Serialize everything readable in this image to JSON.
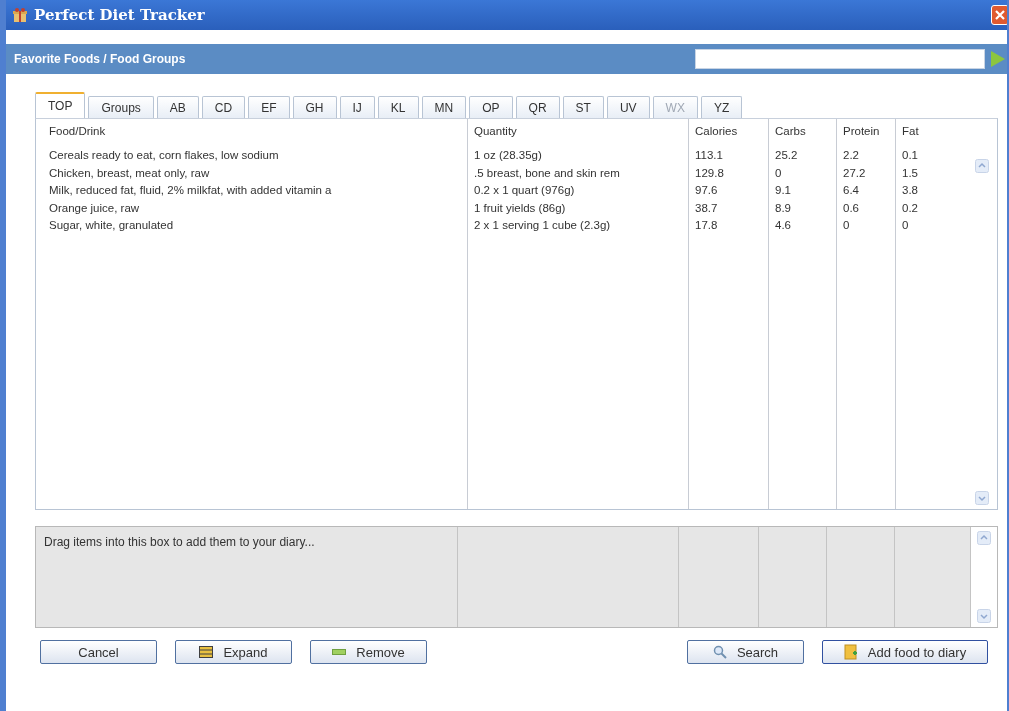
{
  "window": {
    "title": "Perfect Diet Tracker"
  },
  "header": {
    "title": "Favorite Foods / Food Groups"
  },
  "tabs": [
    {
      "label": "TOP",
      "selected": true,
      "disabled": false
    },
    {
      "label": "Groups",
      "selected": false,
      "disabled": false
    },
    {
      "label": "AB",
      "selected": false,
      "disabled": false
    },
    {
      "label": "CD",
      "selected": false,
      "disabled": false
    },
    {
      "label": "EF",
      "selected": false,
      "disabled": false
    },
    {
      "label": "GH",
      "selected": false,
      "disabled": false
    },
    {
      "label": "IJ",
      "selected": false,
      "disabled": false
    },
    {
      "label": "KL",
      "selected": false,
      "disabled": false
    },
    {
      "label": "MN",
      "selected": false,
      "disabled": false
    },
    {
      "label": "OP",
      "selected": false,
      "disabled": false
    },
    {
      "label": "QR",
      "selected": false,
      "disabled": false
    },
    {
      "label": "ST",
      "selected": false,
      "disabled": false
    },
    {
      "label": "UV",
      "selected": false,
      "disabled": false
    },
    {
      "label": "WX",
      "selected": false,
      "disabled": true
    },
    {
      "label": "YZ",
      "selected": false,
      "disabled": false
    }
  ],
  "table": {
    "columns": [
      "Food/Drink",
      "Quantity",
      "Calories",
      "Carbs",
      "Protein",
      "Fat"
    ],
    "rows": [
      [
        "Cereals ready to eat, corn flakes, low sodium",
        "1 oz (28.35g)",
        "113.1",
        "25.2",
        "2.2",
        "0.1"
      ],
      [
        "Chicken, breast, meat only, raw",
        ".5 breast, bone and skin rem",
        "129.8",
        "0",
        "27.2",
        "1.5"
      ],
      [
        "Milk, reduced fat, fluid, 2% milkfat, with added vitamin a",
        "0.2 x 1 quart (976g)",
        "97.6",
        "9.1",
        "6.4",
        "3.8"
      ],
      [
        "Orange juice, raw",
        "1 fruit yields (86g)",
        "38.7",
        "8.9",
        "0.6",
        "0.2"
      ],
      [
        "Sugar, white, granulated",
        "2 x 1 serving 1 cube (2.3g)",
        "17.8",
        "4.6",
        "0",
        "0"
      ]
    ]
  },
  "diary": {
    "hint": "Drag items into this box to add them to your diary..."
  },
  "buttons": [
    {
      "label": "Cancel",
      "kind": "cancel"
    },
    {
      "label": "Expand",
      "kind": "expand"
    },
    {
      "label": "Remove",
      "kind": "remove"
    },
    {
      "label": "Search",
      "kind": "search"
    },
    {
      "label": "Add food to diary",
      "kind": "add"
    }
  ]
}
